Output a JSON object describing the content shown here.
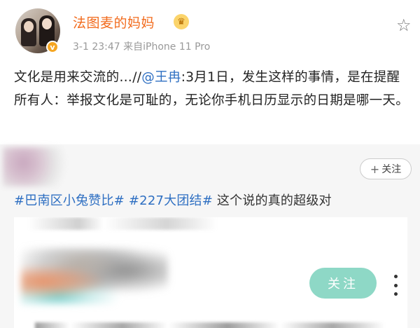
{
  "post": {
    "username": "法图麦的妈妈",
    "verified_badge": "v",
    "crown_icon": "crown-icon",
    "meta": "3-1 23:47  来自iPhone 11 Pro",
    "body_prefix": "文化是用来交流的…//",
    "mention": "@王冉",
    "body_rest": ":3月1日，发生这样的事情，是在提醒所有人：举报文化是可耻的，无论你手机日历显示的日期是哪一天。"
  },
  "repost": {
    "follow_label": "关注",
    "follow_plus": "+",
    "tag1": "#巴南区小兔赞比#",
    "tag2": "#227大团结#",
    "text": " 这个说的真的超级对"
  },
  "card": {
    "follow_label": "关注"
  },
  "colors": {
    "username": "#f26b1d",
    "link": "#2e6fc2",
    "follow_button": "#8ed8c6",
    "repost_background": "#f6f6f6"
  }
}
